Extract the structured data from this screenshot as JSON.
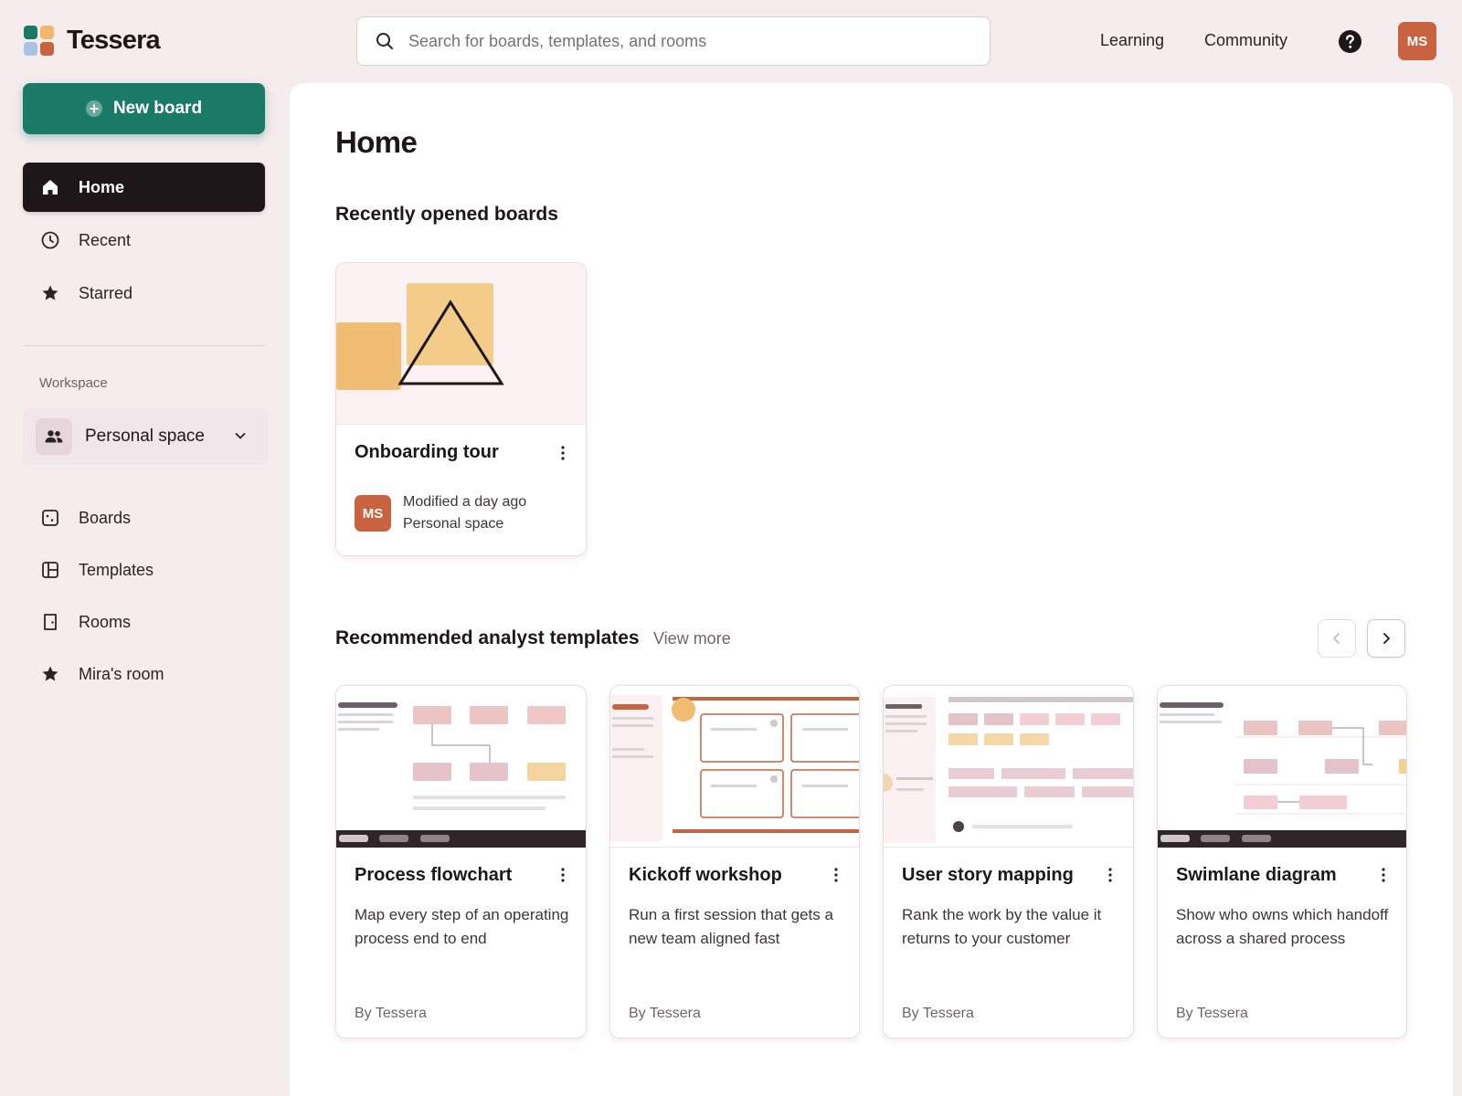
{
  "app": {
    "name": "Tessera",
    "logo_colors": [
      "#1b7a66",
      "#f0b96a",
      "#a7c4e0",
      "#c9623f"
    ]
  },
  "header": {
    "search_placeholder": "Search for boards, templates, and rooms",
    "links": [
      "Learning",
      "Community"
    ],
    "help_icon": "question-circle-icon",
    "avatar_initials": "MS"
  },
  "sidebar": {
    "new_board_label": "New board",
    "primary_nav": [
      {
        "label": "Home",
        "icon": "home-icon",
        "active": true
      },
      {
        "label": "Recent",
        "icon": "clock-icon",
        "active": false
      },
      {
        "label": "Starred",
        "icon": "star-icon",
        "active": false
      }
    ],
    "workspace_label": "Workspace",
    "workspace_selected": "Personal space",
    "workspace_nav": [
      {
        "label": "Boards",
        "icon": "board-icon"
      },
      {
        "label": "Templates",
        "icon": "templates-icon"
      },
      {
        "label": "Rooms",
        "icon": "door-icon"
      },
      {
        "label": "Mira's room",
        "icon": "star-icon"
      }
    ]
  },
  "main": {
    "title": "Home",
    "recent_section_title": "Recently opened boards",
    "recent_boards": [
      {
        "title": "Onboarding tour",
        "owner_initials": "MS",
        "modified": "Modified a day ago",
        "location": "Personal space"
      }
    ],
    "templates_section_title": "Recommended analyst templates",
    "view_more_label": "View more",
    "templates": [
      {
        "title": "Process flowchart",
        "description": "Map every step of an operating process end to end",
        "author": "By Tessera"
      },
      {
        "title": "Kickoff workshop",
        "description": "Run a first session that gets a new team aligned fast",
        "author": "By Tessera"
      },
      {
        "title": "User story mapping",
        "description": "Rank the work by the value it returns to your customer",
        "author": "By Tessera"
      },
      {
        "title": "Swimlane diagram",
        "description": "Show who owns which handoff across a shared process",
        "author": "By Tessera"
      }
    ]
  },
  "colors": {
    "accent": "#1b7a66",
    "avatar": "#c9623f",
    "background": "#f5ecee",
    "active_nav": "#1d1719"
  }
}
